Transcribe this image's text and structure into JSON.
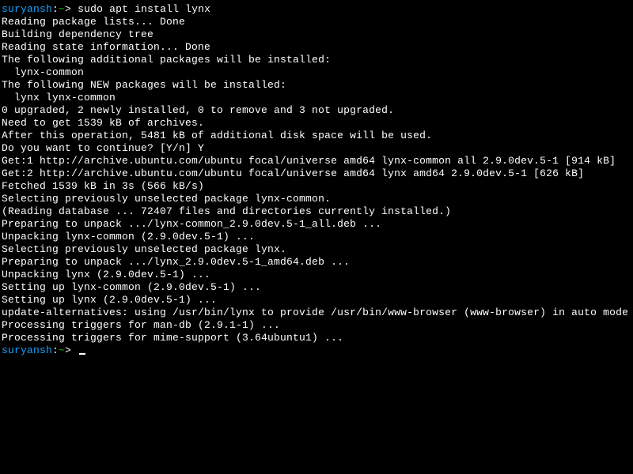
{
  "prompt1": {
    "user": "suryansh",
    "sep": ":",
    "path": "~",
    "sigil": ">",
    "command": "sudo apt install lynx"
  },
  "output": {
    "l01": "Reading package lists... Done",
    "l02": "Building dependency tree",
    "l03": "Reading state information... Done",
    "l04": "The following additional packages will be installed:",
    "l05": "  lynx-common",
    "l06": "The following NEW packages will be installed:",
    "l07": "  lynx lynx-common",
    "l08": "0 upgraded, 2 newly installed, 0 to remove and 3 not upgraded.",
    "l09": "Need to get 1539 kB of archives.",
    "l10": "After this operation, 5481 kB of additional disk space will be used.",
    "l11": "Do you want to continue? [Y/n] Y",
    "l12": "Get:1 http://archive.ubuntu.com/ubuntu focal/universe amd64 lynx-common all 2.9.0dev.5-1 [914 kB]",
    "l13": "Get:2 http://archive.ubuntu.com/ubuntu focal/universe amd64 lynx amd64 2.9.0dev.5-1 [626 kB]",
    "l14": "Fetched 1539 kB in 3s (566 kB/s)",
    "l15": "Selecting previously unselected package lynx-common.",
    "l16": "(Reading database ... 72407 files and directories currently installed.)",
    "l17": "Preparing to unpack .../lynx-common_2.9.0dev.5-1_all.deb ...",
    "l18": "Unpacking lynx-common (2.9.0dev.5-1) ...",
    "l19": "Selecting previously unselected package lynx.",
    "l20": "Preparing to unpack .../lynx_2.9.0dev.5-1_amd64.deb ...",
    "l21": "Unpacking lynx (2.9.0dev.5-1) ...",
    "l22": "Setting up lynx-common (2.9.0dev.5-1) ...",
    "l23": "Setting up lynx (2.9.0dev.5-1) ...",
    "l24": "update-alternatives: using /usr/bin/lynx to provide /usr/bin/www-browser (www-browser) in auto mode",
    "l25": "Processing triggers for man-db (2.9.1-1) ...",
    "l26": "Processing triggers for mime-support (3.64ubuntu1) ..."
  },
  "prompt2": {
    "user": "suryansh",
    "sep": ":",
    "path": "~",
    "sigil": ">"
  }
}
